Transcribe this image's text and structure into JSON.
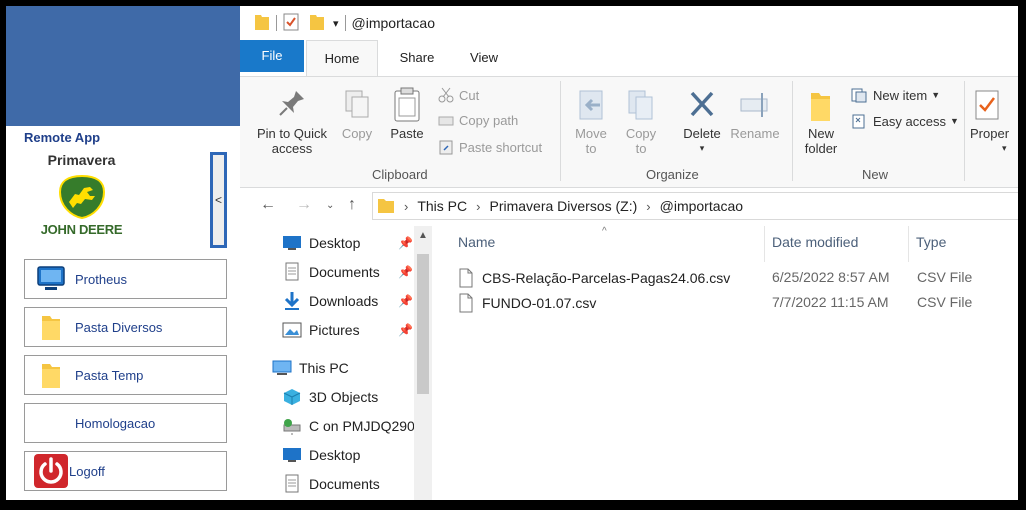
{
  "remote_panel": {
    "title": "Remote App",
    "brand": "Primavera",
    "logo_text": "JOHN DEERE",
    "collapse_glyph": "<",
    "apps": [
      {
        "label": "Protheus",
        "icon": "computer-icon"
      },
      {
        "label": "Pasta Diversos",
        "icon": "folder-icon"
      },
      {
        "label": "Pasta Temp",
        "icon": "folder-icon"
      },
      {
        "label": "Homologacao",
        "icon": ""
      },
      {
        "label": "Logoff",
        "icon": "power-icon"
      }
    ]
  },
  "window": {
    "title": "@importacao"
  },
  "ribbon": {
    "tabs": [
      "File",
      "Home",
      "Share",
      "View"
    ],
    "clipboard": {
      "pin": "Pin to Quick access",
      "copy": "Copy",
      "paste": "Paste",
      "cut": "Cut",
      "copy_path": "Copy path",
      "paste_shortcut": "Paste shortcut",
      "group": "Clipboard"
    },
    "organize": {
      "move_to": "Move to",
      "copy_to": "Copy to",
      "delete": "Delete",
      "rename": "Rename",
      "group": "Organize"
    },
    "new": {
      "new_folder": "New folder",
      "new_item": "New item",
      "easy_access": "Easy access",
      "group": "New"
    },
    "open": {
      "properties": "Proper"
    }
  },
  "address": {
    "crumbs": [
      "This PC",
      "Primavera Diversos (Z:)",
      "@importacao"
    ]
  },
  "nav_pane": {
    "quick_access": [
      "Desktop",
      "Documents",
      "Downloads",
      "Pictures"
    ],
    "this_pc": "This PC",
    "this_pc_items": [
      "3D Objects",
      "C on PMJDQ290",
      "Desktop",
      "Documents"
    ]
  },
  "file_list": {
    "columns": {
      "name": "Name",
      "date": "Date modified",
      "type": "Type"
    },
    "files": [
      {
        "name": "CBS-Relação-Parcelas-Pagas24.06.csv",
        "date": "6/25/2022 8:57 AM",
        "type": "CSV File"
      },
      {
        "name": "FUNDO-01.07.csv",
        "date": "7/7/2022 11:15 AM",
        "type": "CSV File"
      }
    ]
  },
  "colors": {
    "accent": "#1979ca",
    "banner": "#3f6aa8",
    "deere_green": "#367c2b",
    "deere_yellow": "#ffde00",
    "logoff_red": "#d0272c"
  }
}
